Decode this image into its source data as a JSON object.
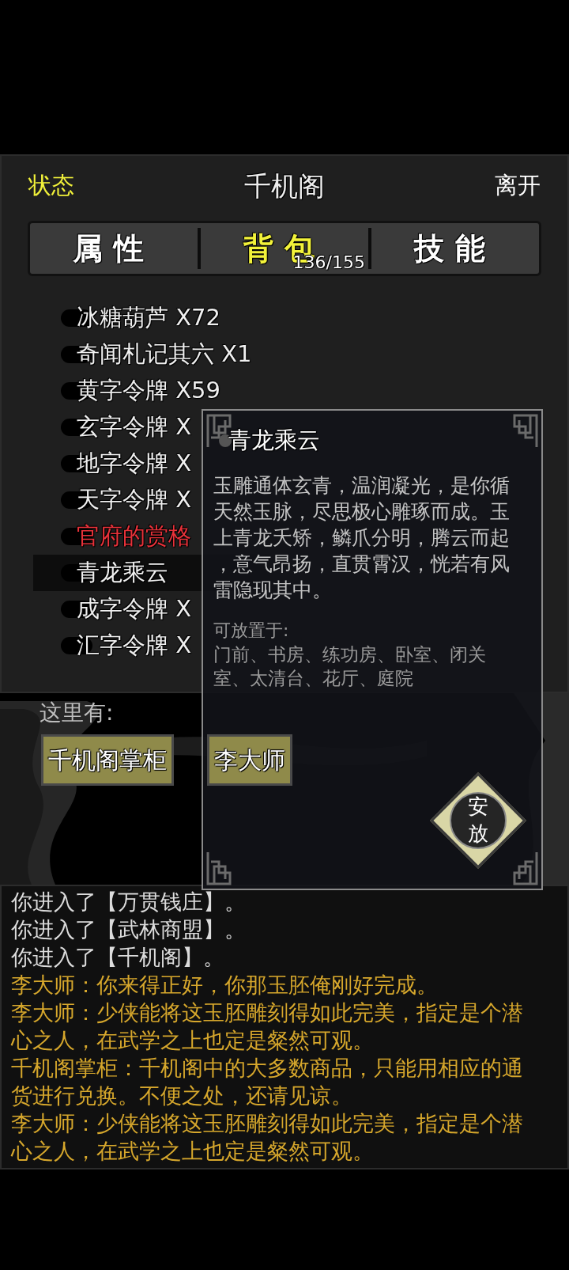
{
  "header": {
    "status_button": "状态",
    "title": "千机阁",
    "leave_button": "离开"
  },
  "tabs": [
    {
      "label": "属性",
      "selected": false
    },
    {
      "label": "背包",
      "selected": true,
      "count": "136/155"
    },
    {
      "label": "技能",
      "selected": false
    }
  ],
  "inventory": [
    {
      "name": "冰糖葫芦 X72",
      "color": "#f0f0f0",
      "selected": false
    },
    {
      "name": "奇闻札记其六 X1",
      "color": "#f0f0f0",
      "selected": false
    },
    {
      "name": "黄字令牌 X59",
      "color": "#f0f0f0",
      "selected": false
    },
    {
      "name": "玄字令牌 X",
      "color": "#f0f0f0",
      "selected": false
    },
    {
      "name": "地字令牌 X",
      "color": "#f0f0f0",
      "selected": false
    },
    {
      "name": "天字令牌 X",
      "color": "#f0f0f0",
      "selected": false
    },
    {
      "name": "官府的赏格",
      "color": "#e8323a",
      "selected": false
    },
    {
      "name": "青龙乘云",
      "color": "#f0f0f0",
      "selected": true
    },
    {
      "name": "成字令牌 X",
      "color": "#f0f0f0",
      "selected": false
    },
    {
      "name": "汇字令牌 X",
      "color": "#f0f0f0",
      "selected": false
    }
  ],
  "here": {
    "label": "这里有:",
    "npcs": [
      "千机阁掌柜",
      "李大师"
    ]
  },
  "popup": {
    "title": "青龙乘云",
    "description": "玉雕通体玄青，温润凝光，是你循天然玉脉，尽思极心雕琢而成。玉上青龙夭矫，鳞爪分明，腾云而起，意气昂扬，直贯霄汉，恍若有风雷隐现其中。",
    "place_label": "可放置于:",
    "places": "门前、书房、练功房、卧室、闭关室、太清台、花厅、庭院",
    "action_button": "安放"
  },
  "log": [
    {
      "kind": "system",
      "text": "你进入了【万贯钱庄】。"
    },
    {
      "kind": "system",
      "text": "你进入了【武林商盟】。"
    },
    {
      "kind": "system",
      "text": "你进入了【千机阁】。"
    },
    {
      "kind": "dialog",
      "text": "李大师：你来得正好，你那玉胚俺刚好完成。"
    },
    {
      "kind": "dialog",
      "text": "李大师：少侠能将这玉胚雕刻得如此完美，指定是个潜心之人，在武学之上也定是粲然可观。"
    },
    {
      "kind": "dialog",
      "text": "千机阁掌柜：千机阁中的大多数商品，只能用相应的通货进行兑换。不便之处，还请见谅。"
    },
    {
      "kind": "dialog",
      "text": "李大师：少侠能将这玉胚雕刻得如此完美，指定是个潜心之人，在武学之上也定是粲然可观。"
    }
  ]
}
